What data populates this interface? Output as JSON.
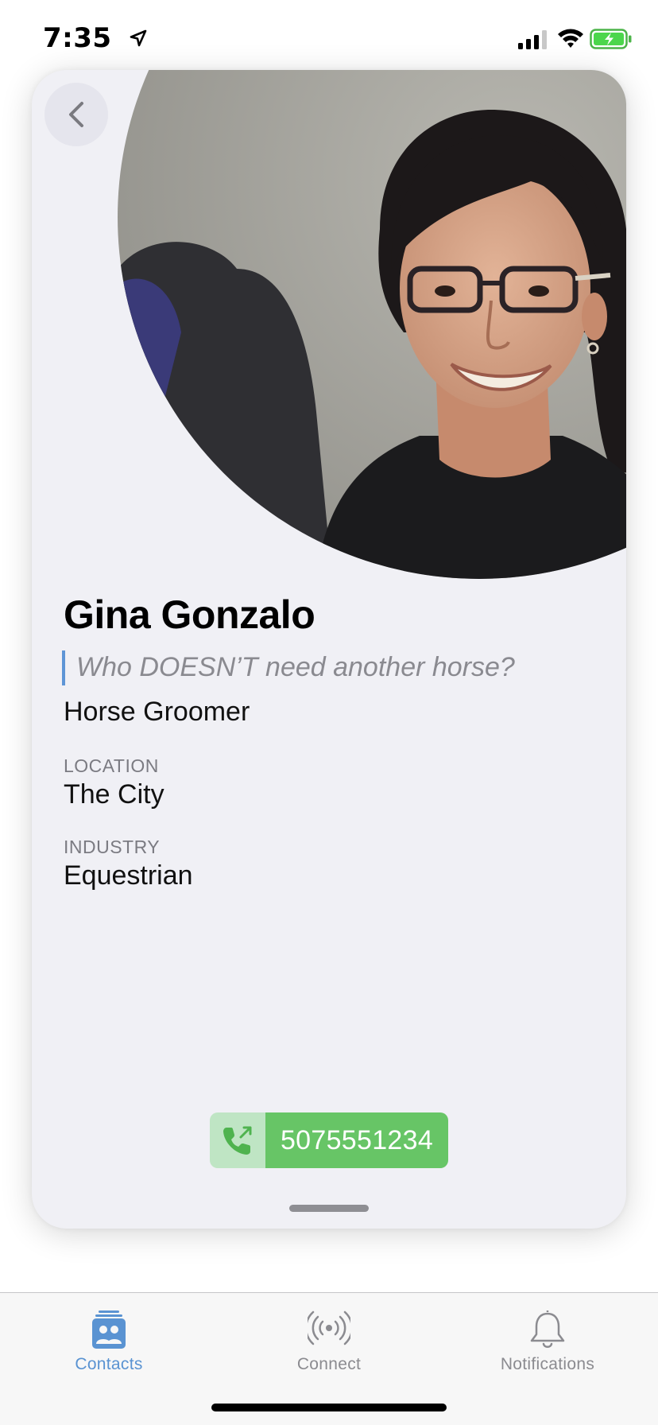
{
  "status_bar": {
    "time": "7:35"
  },
  "profile": {
    "name": "Gina Gonzalo",
    "tagline": "Who DOESN’T need another horse?",
    "job_title": "Horse Groomer",
    "location_label": "LOCATION",
    "location_value": "The City",
    "industry_label": "INDUSTRY",
    "industry_value": "Equestrian",
    "phone": "5075551234"
  },
  "tabs": [
    {
      "label": "Contacts",
      "icon": "contacts-icon",
      "active": true
    },
    {
      "label": "Connect",
      "icon": "broadcast-icon",
      "active": false
    },
    {
      "label": "Notifications",
      "icon": "bell-icon",
      "active": false
    }
  ],
  "colors": {
    "accent": "#5a93d2",
    "phone_green": "#67c566",
    "phone_icon_bg": "#bfe5c4",
    "card_bg": "#f0f0f5",
    "quote_bar": "#5e95d6"
  }
}
